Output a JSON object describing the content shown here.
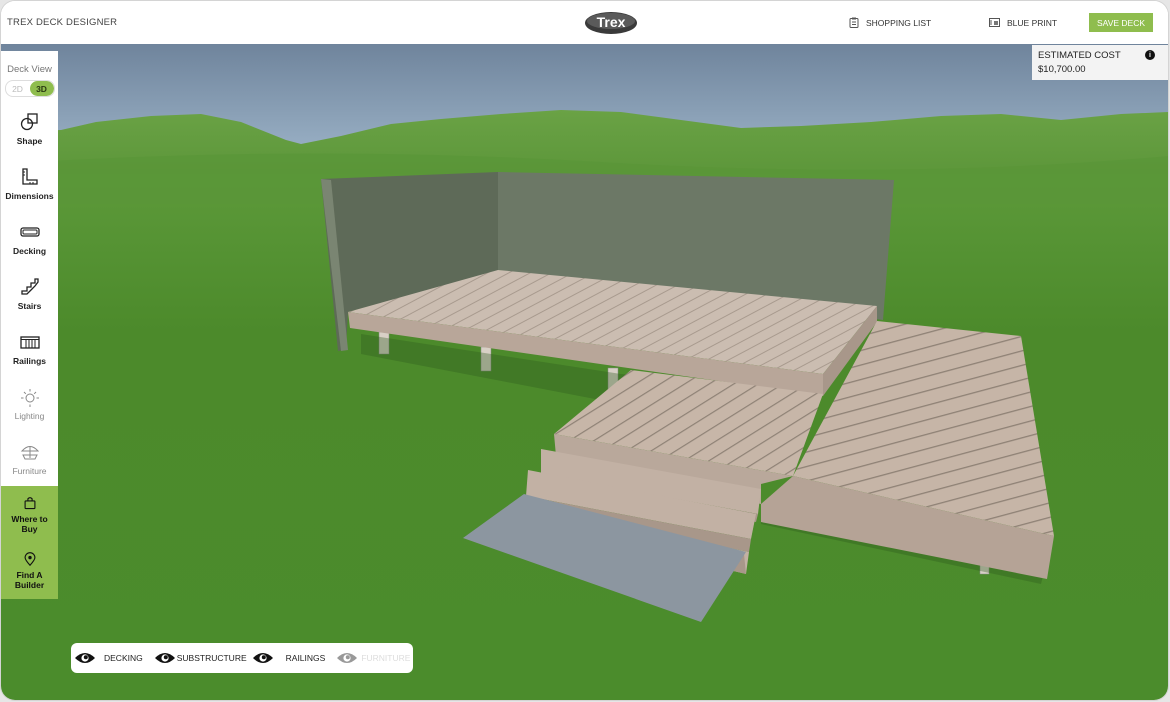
{
  "header": {
    "app_title": "TREX DECK DESIGNER",
    "logo_text": "Trex",
    "shopping_list_label": "SHOPPING LIST",
    "blue_print_label": "BLUE PRINT",
    "save_label": "SAVE DECK"
  },
  "sidebar": {
    "view_title": "Deck View",
    "view_toggle": {
      "options": [
        "2D",
        "3D"
      ],
      "selected": "3D"
    },
    "items": [
      {
        "label": "Shape",
        "icon": "shape-icon",
        "enabled": true
      },
      {
        "label": "Dimensions",
        "icon": "ruler-icon",
        "enabled": true
      },
      {
        "label": "Decking",
        "icon": "decking-board-icon",
        "enabled": true
      },
      {
        "label": "Stairs",
        "icon": "stairs-icon",
        "enabled": true
      },
      {
        "label": "Railings",
        "icon": "railing-icon",
        "enabled": true
      },
      {
        "label": "Lighting",
        "icon": "sun-icon",
        "enabled": false
      },
      {
        "label": "Furniture",
        "icon": "umbrella-table-icon",
        "enabled": false
      }
    ],
    "actions": [
      {
        "label": "Where to Buy",
        "icon": "shopping-bag-icon"
      },
      {
        "label": "Find A Builder",
        "icon": "location-pin-icon"
      }
    ]
  },
  "estimate": {
    "title": "ESTIMATED COST",
    "value": "$10,700.00",
    "info_icon": "info-icon"
  },
  "layers": [
    {
      "label": "DECKING",
      "visible": true
    },
    {
      "label": "SUBSTRUCTURE",
      "visible": true
    },
    {
      "label": "RAILINGS",
      "visible": true
    },
    {
      "label": "FURNITURE",
      "visible": false
    }
  ],
  "colors": {
    "accent_green": "#8fbd4e",
    "deck_board": "#c9b8ab",
    "wall": "#6b7763",
    "grass": "#4f8b2e",
    "sky": "#7e95ab"
  }
}
